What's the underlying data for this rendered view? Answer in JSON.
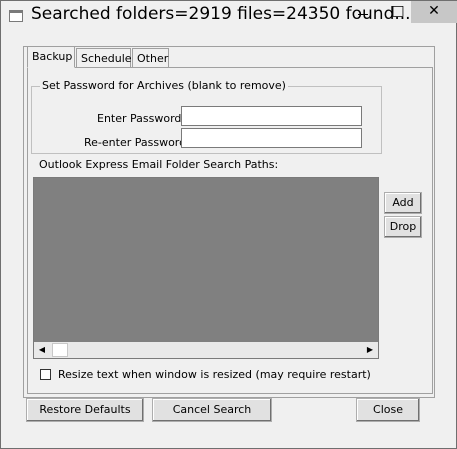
{
  "window": {
    "title": "Searched folders=2919 files=24350 found...",
    "minimize": "",
    "maximize": "□",
    "close": "✕"
  },
  "tabs": [
    {
      "label": "Backup",
      "selected": true
    },
    {
      "label": "Schedule",
      "selected": false
    },
    {
      "label": "Other",
      "selected": false
    }
  ],
  "password_group": {
    "title": "Set Password for Archives (blank to remove)",
    "enter_label": "Enter Password:",
    "enter_value": "",
    "reenter_label": "Re-enter Password:",
    "reenter_value": ""
  },
  "paths": {
    "label": "Outlook Express Email Folder Search Paths:",
    "items": []
  },
  "scroll": {
    "left": "◀",
    "right": "▶"
  },
  "side_buttons": {
    "add": "Add",
    "drop": "Drop"
  },
  "resize_option": {
    "label": "Resize text when window is resized (may require restart)",
    "checked": false
  },
  "footer": {
    "restore": "Restore Defaults",
    "cancel": "Cancel Search",
    "close": "Close"
  }
}
